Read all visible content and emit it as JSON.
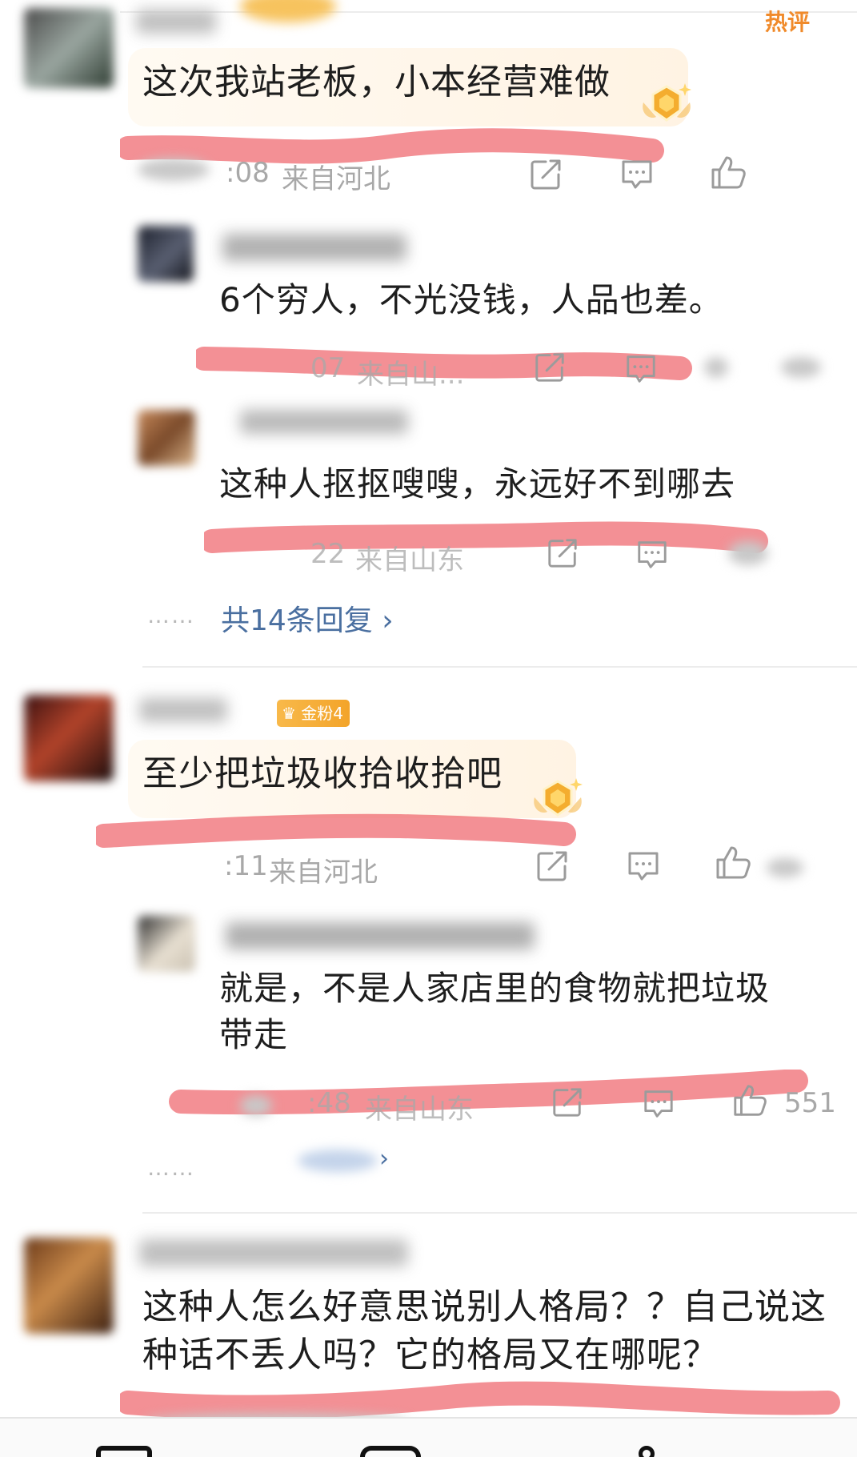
{
  "top_right_label": "热评",
  "comments": [
    {
      "text": "这次我站老板，小本经营难做",
      "time": ":08",
      "location": "来自河北",
      "replies": [
        {
          "text": "6个穷人，不光没钱，人品也差。",
          "time": "07",
          "location": "来自山..."
        },
        {
          "text": "这种人抠抠嗖嗖，永远好不到哪去",
          "time": "22",
          "location": "来自山东"
        }
      ],
      "more_replies": "共14条回复 ›",
      "more_dots": "……"
    },
    {
      "badge": "金粉4",
      "text": "至少把垃圾收拾收拾吧",
      "time": ":11",
      "location": "来自河北",
      "replies": [
        {
          "text_line1": "就是，不是人家店里的食物就把垃圾",
          "text_line2": "带走",
          "time": ":48",
          "location": "来自山东",
          "likes": "551"
        }
      ],
      "more_dots": "……",
      "more_replies_arrow": "›"
    },
    {
      "text_line1": "这种人怎么好意思说别人格局？？自己说这",
      "text_line2": "种话不丢人吗？它的格局又在哪呢？"
    }
  ],
  "icons": {
    "share": "share-icon",
    "comment": "comment-icon",
    "like": "thumbs-up-icon",
    "crown": "crown-badge-icon"
  },
  "colors": {
    "marker": "#ef6b72",
    "link": "#4a6fa0",
    "badge": "#f5ad35",
    "meta": "#a8a8a8"
  }
}
